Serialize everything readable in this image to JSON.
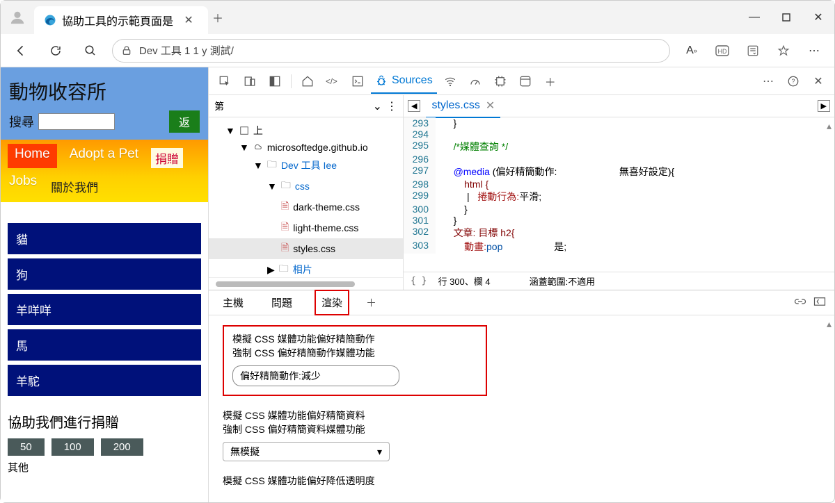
{
  "window": {
    "tab_title": "協助工具的示範頁面是"
  },
  "toolbar": {
    "url": "Dev 工具 1 1 y 測試/"
  },
  "site": {
    "title": "動物收容所",
    "search_label": "搜尋",
    "return_btn": "返",
    "nav": {
      "home": "Home",
      "adopt": "Adopt a Pet",
      "donate": "捐贈",
      "jobs": "Jobs",
      "about": "關於我們"
    },
    "animals": [
      "貓",
      "狗",
      "羊咩咩",
      "馬",
      "羊駝"
    ],
    "donate_heading": "協助我們進行捐贈",
    "donate_amounts": [
      "50",
      "100",
      "200"
    ],
    "other": "其他"
  },
  "devtools": {
    "active_panel": "Sources",
    "page_label": "第",
    "tree": {
      "top": "上",
      "domain": "microsoftedge.github.io",
      "folder1": "Dev 工具 Iee",
      "css": "css",
      "files": [
        "dark-theme.css",
        "light-theme.css",
        "styles.css"
      ],
      "photos": "相片"
    },
    "open_file": "styles.css",
    "code": {
      "293": "}",
      "294": "",
      "295": "/*媒體查詢 */",
      "296": "",
      "297_a": "@media",
      "297_b": " (偏好精簡動作:",
      "297_c": "無喜好設定){",
      "298": "html {",
      "299_a": "捲動行為:",
      "299_b": "平滑;",
      "300": "}",
      "301": "}",
      "302_a": "文章: 目標 h2{",
      "303_a": "動畫:",
      "303_b": "pop",
      "303_c": "是;"
    },
    "status": {
      "pos": "行 300、欄 4",
      "coverage": "涵蓋範圍:不適用"
    }
  },
  "drawer": {
    "tabs": {
      "console": "主機",
      "issues": "問題",
      "rendering": "渲染"
    },
    "motion": {
      "title": "模擬 CSS 媒體功能偏好精簡動作",
      "subtitle": "強制 CSS 偏好精簡動作媒體功能",
      "value": "偏好精簡動作:減少"
    },
    "data_pref": {
      "title": "模擬 CSS 媒體功能偏好精簡資料",
      "subtitle": "強制 CSS 偏好精簡資料媒體功能",
      "value": "無模擬"
    },
    "transparency": {
      "title": "模擬 CSS 媒體功能偏好降低透明度"
    }
  }
}
